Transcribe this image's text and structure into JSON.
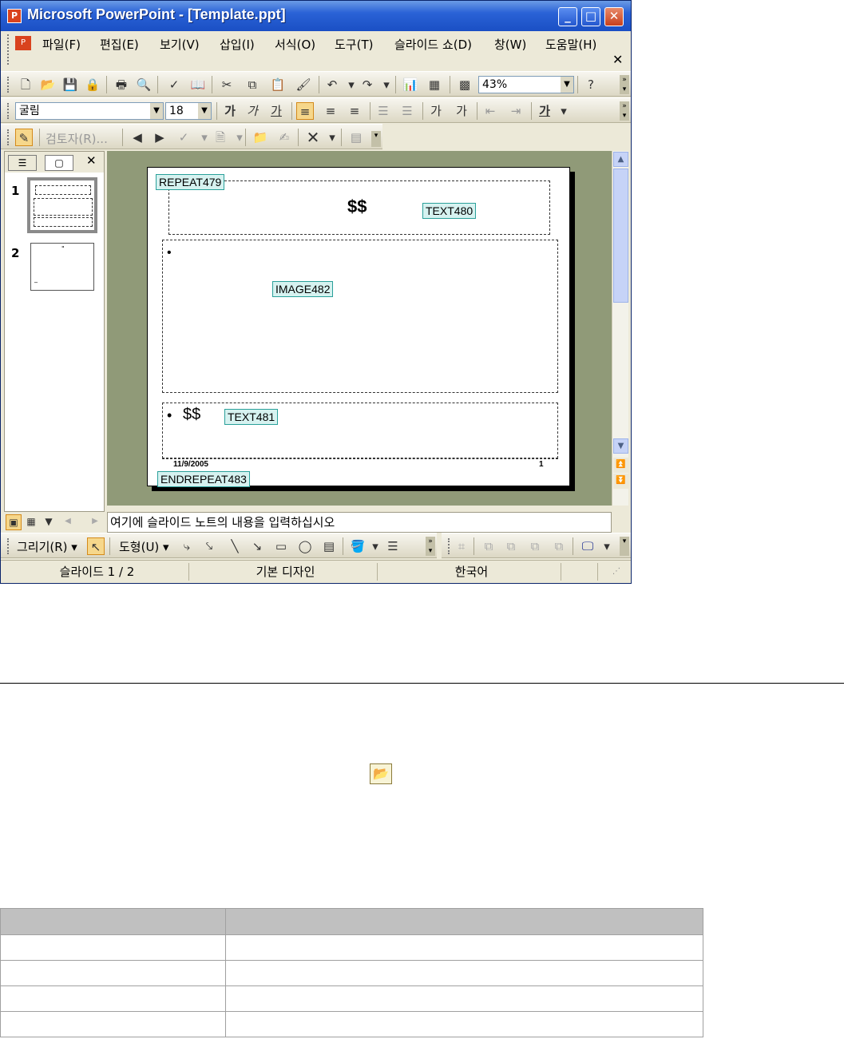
{
  "window": {
    "title": "Microsoft PowerPoint - [Template.ppt]",
    "controls": {
      "minimize": "_",
      "maximize": "□",
      "close": "✕"
    }
  },
  "menu": [
    {
      "label": "파일(F)"
    },
    {
      "label": "편집(E)"
    },
    {
      "label": "보기(V)"
    },
    {
      "label": "삽입(I)"
    },
    {
      "label": "서식(O)"
    },
    {
      "label": "도구(T)"
    },
    {
      "label": "슬라이드 쇼(D)"
    },
    {
      "label": "창(W)"
    },
    {
      "label": "도움말(H)"
    }
  ],
  "standard_toolbar": {
    "zoom": "43%",
    "icons": [
      "new-icon",
      "open-icon",
      "save-icon",
      "permission-icon",
      "print-icon",
      "print-preview-icon",
      "spelling-icon",
      "research-icon",
      "cut-icon",
      "copy-icon",
      "paste-icon",
      "format-painter-icon",
      "undo-icon",
      "redo-icon",
      "chart-icon",
      "table-icon",
      "grid-icon",
      "help-icon"
    ]
  },
  "format_toolbar": {
    "font": "굴림",
    "size": "18",
    "bold": "가",
    "italic": "가",
    "underline": "가",
    "font_color": "가"
  },
  "review_toolbar": {
    "reviewer": "검토자(R)..."
  },
  "outline_tabs": {
    "outline": "☰",
    "slides": "▢",
    "close": "✕"
  },
  "thumbnails": [
    {
      "number": "1"
    },
    {
      "number": "2"
    }
  ],
  "slide": {
    "tags": {
      "repeat": "REPEAT479",
      "text1": "TEXT480",
      "image": "IMAGE482",
      "text2": "TEXT481",
      "endrepeat": "ENDREPEAT483"
    },
    "title_placeholder": "$$",
    "bullet": "•",
    "body_placeholder": "$$",
    "footer_date": "11/9/2005",
    "footer_page": "1"
  },
  "notes": {
    "placeholder": "여기에 슬라이드 노트의 내용을 입력하십시오"
  },
  "drawing_toolbar": {
    "draw": "그리기(R) ▾",
    "autoshapes": "도형(U) ▾"
  },
  "status": {
    "slide": "슬라이드 1 / 2",
    "design": "기본 디자인",
    "language": "한국어"
  },
  "table": {
    "rows": 4,
    "header_color": "#c0c0c0"
  }
}
